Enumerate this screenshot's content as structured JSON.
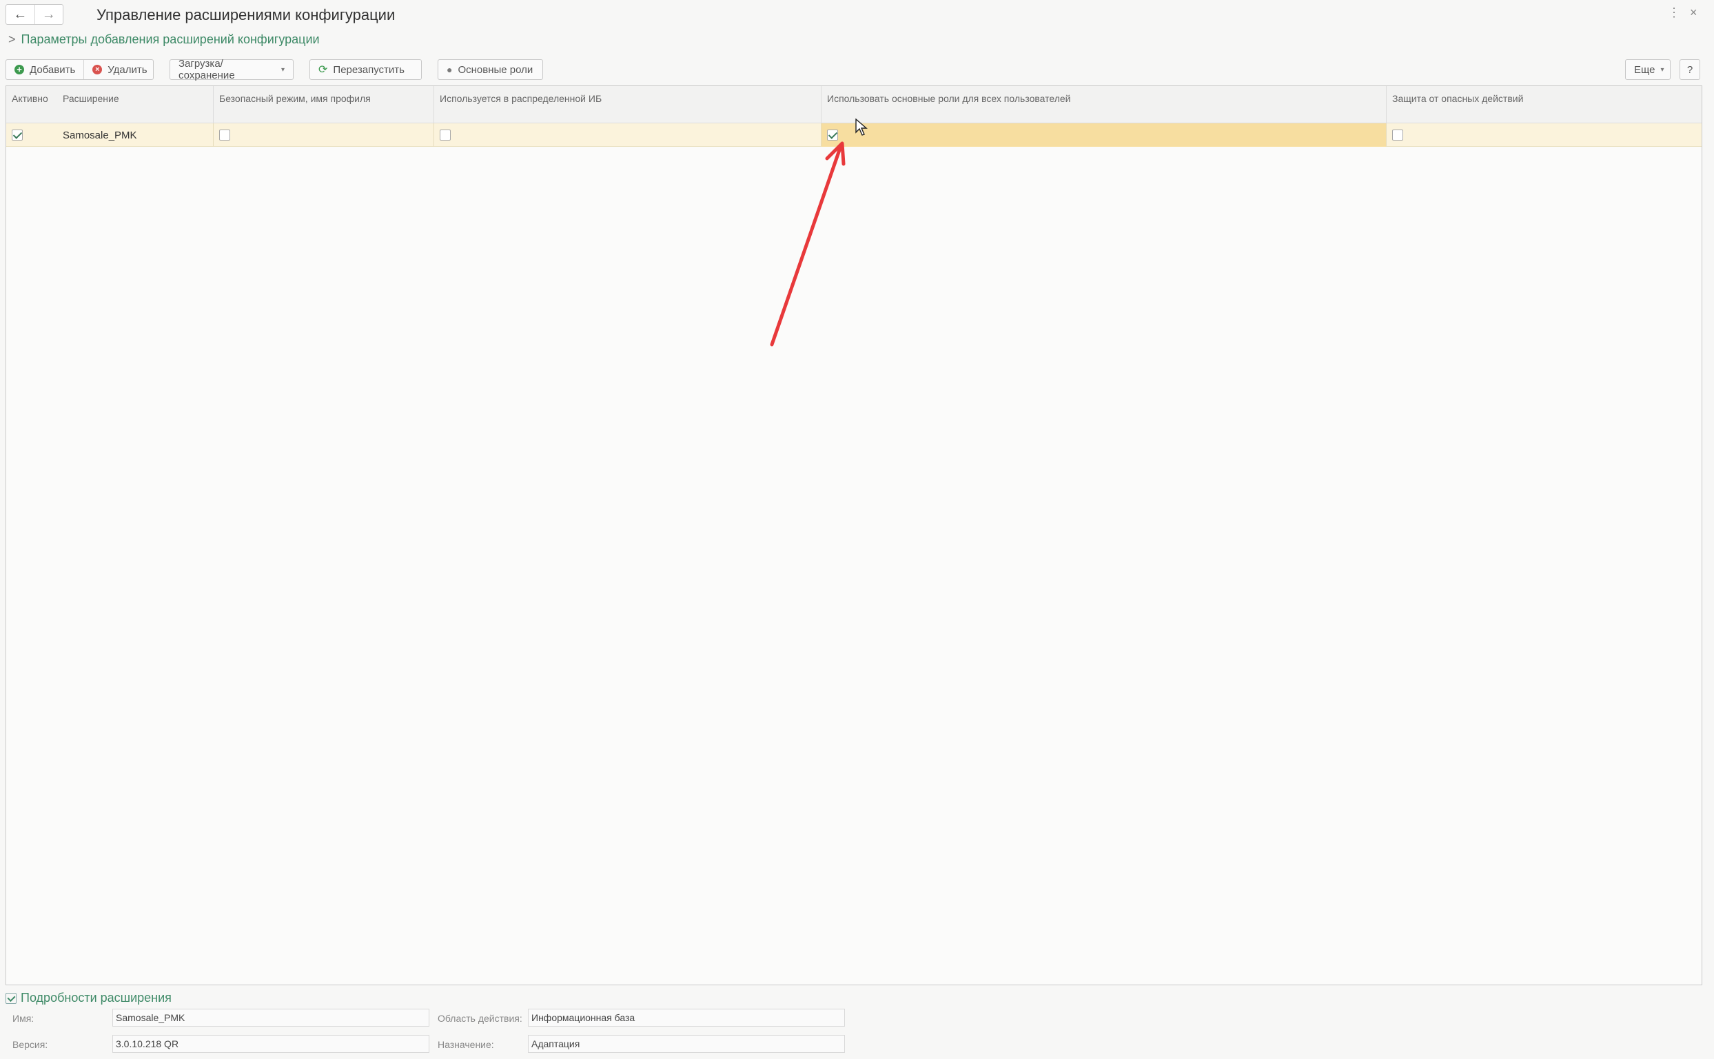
{
  "window": {
    "title": "Управление расширениями конфигурации",
    "nav_back": "←",
    "nav_forward": "→",
    "menu_glyph": "⋮",
    "close_glyph": "×"
  },
  "params_link": {
    "chevron": ">",
    "label": "Параметры добавления расширений конфигурации"
  },
  "toolbar": {
    "add_label": "Добавить",
    "delete_label": "Удалить",
    "load_save_label": "Загрузка/сохранение",
    "restart_label": "Перезапустить",
    "main_roles_label": "Основные роли",
    "more_label": "Еще",
    "help_label": "?",
    "caret": "▾"
  },
  "table": {
    "columns": [
      "Активно",
      "Расширение",
      "Безопасный режим, имя профиля",
      "Используется в распределенной ИБ",
      "Использовать основные роли для всех пользователей",
      "Защита от опасных действий"
    ],
    "rows": [
      {
        "active": true,
        "extension": "Samosale_PMK",
        "safe_mode": false,
        "distributed_ib": false,
        "use_main_roles": true,
        "danger_protection": false
      }
    ]
  },
  "details": {
    "header": "Подробности расширения",
    "name_label": "Имя:",
    "name_value": "Samosale_PMK",
    "version_label": "Версия:",
    "version_value": "3.0.10.218 QR",
    "scope_label": "Область действия:",
    "scope_value": "Информационная база",
    "purpose_label": "Назначение:",
    "purpose_value": "Адаптация"
  },
  "annotation": {
    "arrow_color": "#e8393b"
  }
}
